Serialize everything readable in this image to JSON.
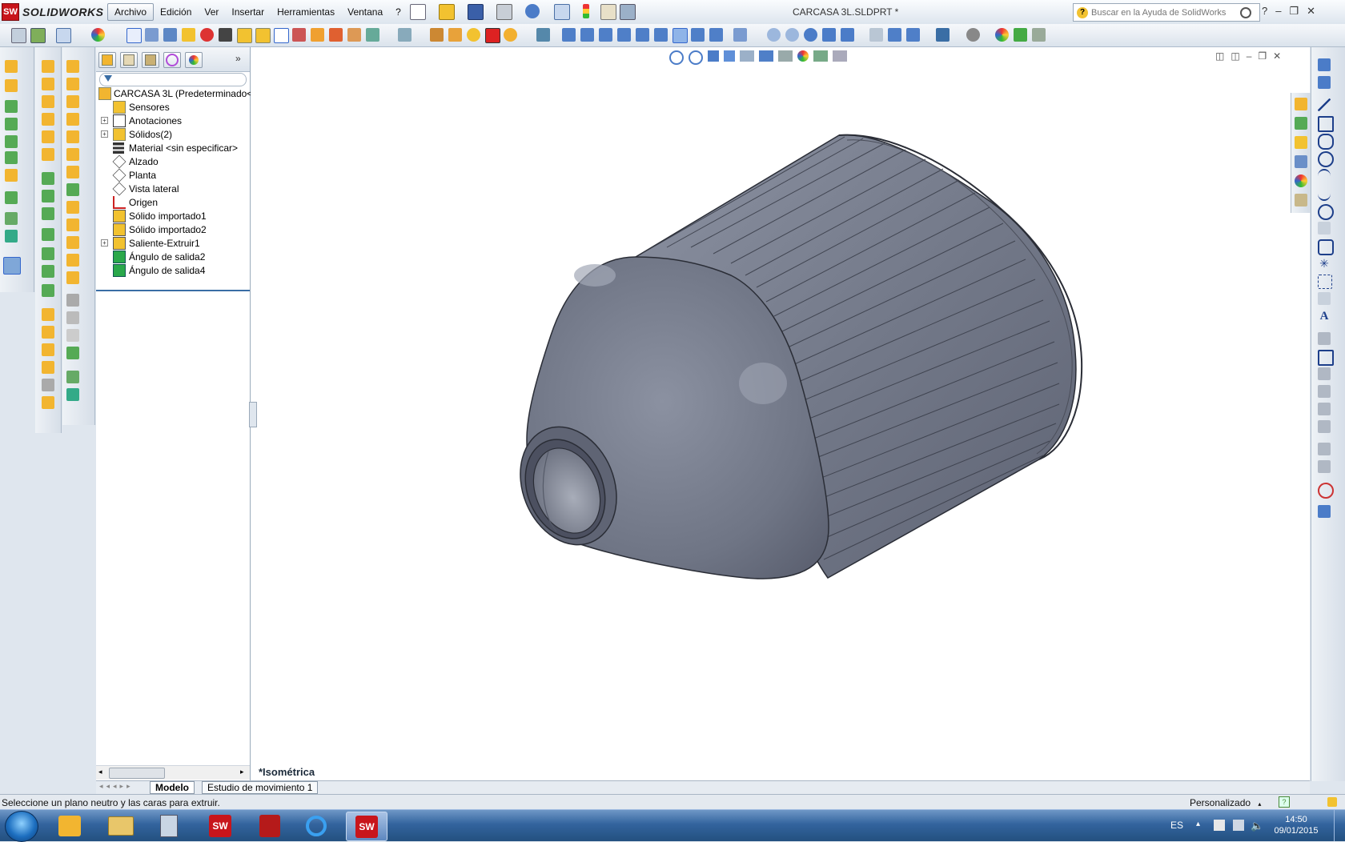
{
  "app": {
    "brand": "SOLIDWORKS",
    "brand_badge": "SW",
    "doc_title": "CARCASA 3L.SLDPRT *"
  },
  "menu": [
    "Archivo",
    "Edición",
    "Ver",
    "Insertar",
    "Herramientas",
    "Ventana",
    "?"
  ],
  "help_search": {
    "placeholder": "Buscar en la Ayuda de SolidWorks"
  },
  "feature_tree": {
    "root": "CARCASA 3L  (Predeterminado<",
    "items": [
      {
        "label": "Sensores",
        "icon": "sensor-folder-icon",
        "expandable": false
      },
      {
        "label": "Anotaciones",
        "icon": "annotations-icon",
        "expandable": true
      },
      {
        "label": "Sólidos(2)",
        "icon": "solid-bodies-folder-icon",
        "expandable": true
      },
      {
        "label": "Material <sin especificar>",
        "icon": "material-icon",
        "expandable": false
      },
      {
        "label": "Alzado",
        "icon": "plane-icon",
        "expandable": false
      },
      {
        "label": "Planta",
        "icon": "plane-icon",
        "expandable": false
      },
      {
        "label": "Vista lateral",
        "icon": "plane-icon",
        "expandable": false
      },
      {
        "label": "Origen",
        "icon": "origin-icon",
        "expandable": false
      },
      {
        "label": "Sólido importado1",
        "icon": "imported-body-icon",
        "expandable": false
      },
      {
        "label": "Sólido importado2",
        "icon": "imported-body-icon",
        "expandable": false
      },
      {
        "label": "Saliente-Extruir1",
        "icon": "boss-extrude-icon",
        "expandable": true
      },
      {
        "label": "Ángulo de salida2",
        "icon": "draft-icon",
        "expandable": false
      },
      {
        "label": "Ángulo de salida4",
        "icon": "draft-icon",
        "expandable": false
      }
    ]
  },
  "viewport": {
    "view_name": "*Isométrica"
  },
  "bottom_tabs": [
    "Modelo",
    "Estudio de movimiento 1"
  ],
  "status": {
    "message": "Seleccione un plano neutro y las caras para extruir.",
    "units": "Personalizado"
  },
  "taskbar": {
    "apps": [
      "outlook-icon",
      "explorer-icon",
      "calculator-icon",
      "solidworks-icon",
      "acrobat-icon",
      "internet-explorer-icon",
      "solidworks-icon"
    ],
    "lang": "ES",
    "time": "14:50",
    "date": "09/01/2015"
  },
  "colors": {
    "accent": "#3a6ea5",
    "model": "#6f7585",
    "brand_red": "#c8151b"
  }
}
